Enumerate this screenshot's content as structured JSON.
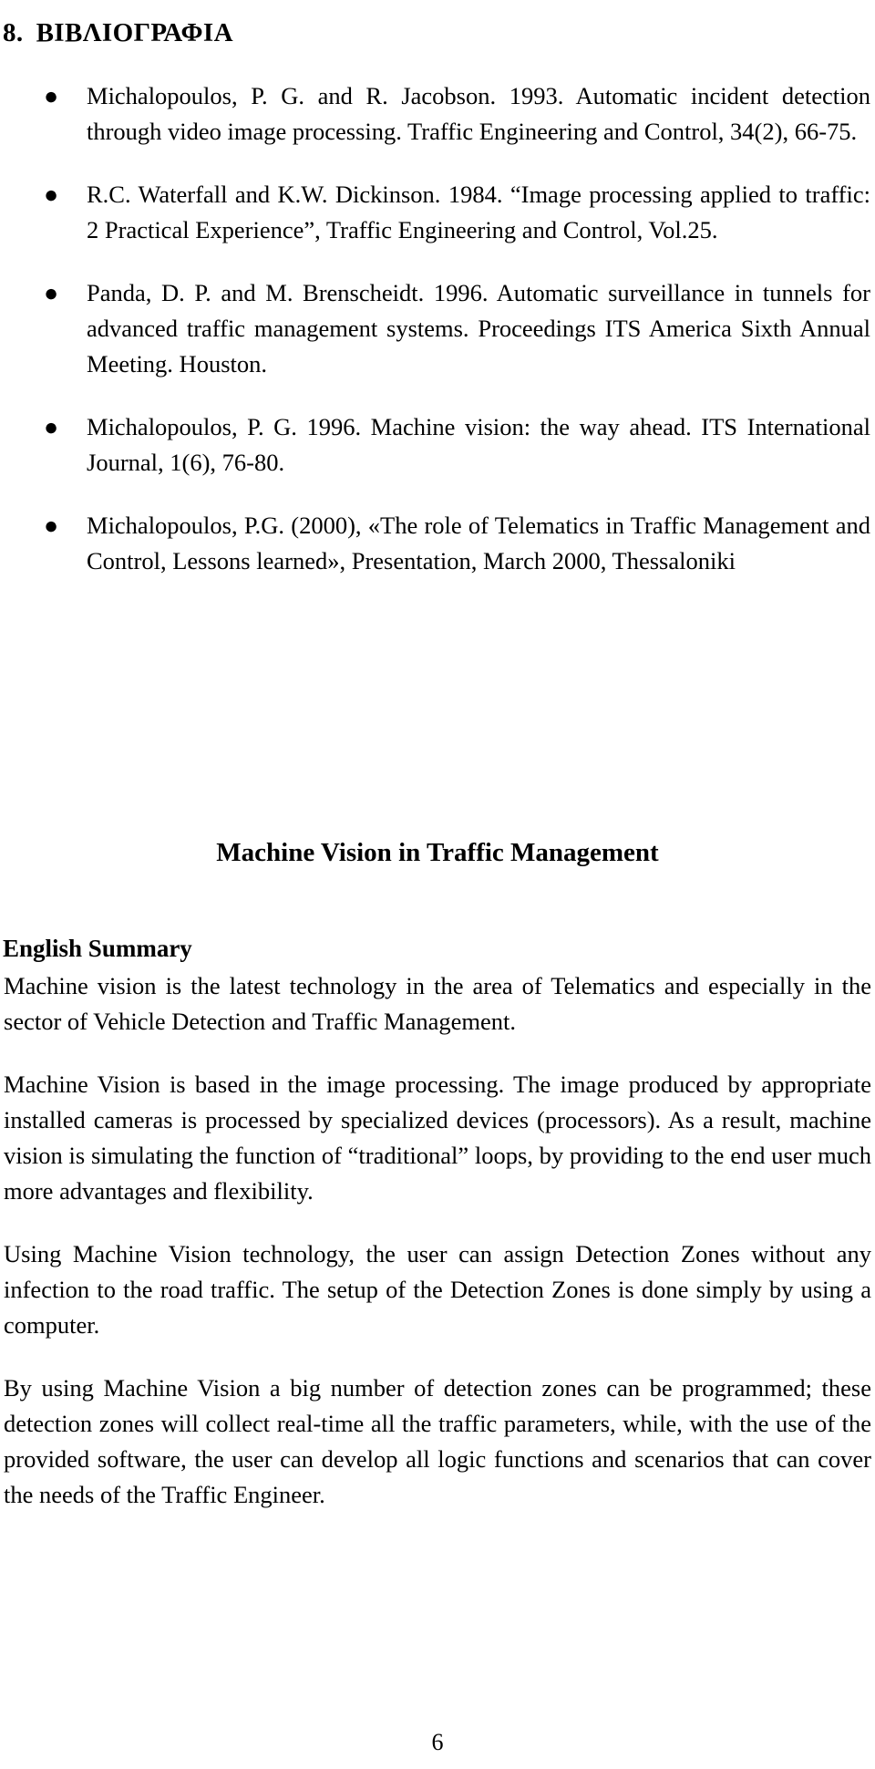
{
  "section": {
    "number": "8.",
    "title": "ΒΙΒΛΙΟΓΡΑΦΙΑ"
  },
  "bullet_glyph": "●",
  "bibliography": [
    {
      "text": "Michalopoulos, P. G. and R. Jacobson.  1993.  Automatic incident detection through video image processing.  Traffic Engineering and Control, 34(2), 66-75."
    },
    {
      "text": "R.C. Waterfall and K.W. Dickinson. 1984. “Image processing applied to traffic: 2 Practical Experience”, Traffic Engineering and Control, Vol.25."
    },
    {
      "text": "Panda, D. P. and M. Brenscheidt.  1996.  Automatic surveillance in tunnels for advanced traffic management systems.  Proceedings ITS America Sixth Annual Meeting.  Houston."
    },
    {
      "text": "Michalopoulos, P. G.  1996.  Machine vision: the way ahead.  ITS International Journal, 1(6), 76-80."
    },
    {
      "text": "Michalopoulos, P.G. (2000), «The role of Telematics in Traffic Management and Control, Lessons learned», Presentation, March 2000, Thessaloniki"
    }
  ],
  "document_title": "Machine Vision in Traffic Management",
  "summary_heading": "English Summary",
  "paragraphs": [
    "Machine vision is the latest technology in the area of Telematics and especially in the sector of Vehicle Detection and Traffic Management.",
    "Machine Vision is based in the image processing. The image produced by appropriate installed cameras is processed by specialized devices (processors).  As a result, machine vision is simulating the function of “traditional” loops, by providing to the end user much more advantages and flexibility.",
    "Using Machine Vision technology, the user can assign Detection Zones without any infection to the road traffic. The setup of the Detection Zones is done simply by using a computer.",
    "By using Machine Vision a big number of detection zones can be programmed; these detection zones will collect real-time all the traffic parameters, while, with the use of the provided software, the user can develop all logic functions and scenarios that can cover the needs of the Traffic Engineer."
  ],
  "page_number": "6"
}
